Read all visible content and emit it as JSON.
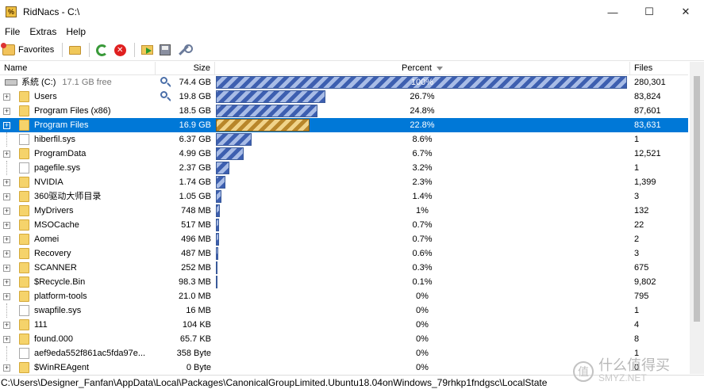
{
  "window": {
    "title": "RidNacs - C:\\",
    "icon_glyph": "%",
    "minimize_glyph": "—",
    "maximize_glyph": "☐",
    "close_glyph": "✕"
  },
  "menu": [
    {
      "label": "File"
    },
    {
      "label": "Extras"
    },
    {
      "label": "Help"
    }
  ],
  "toolbar": {
    "favorites_label": "Favorites",
    "icons": [
      "open-folder-icon",
      "refresh-icon",
      "stop-icon",
      "export-icon",
      "save-icon",
      "settings-wrench-icon"
    ]
  },
  "columns": {
    "name": "Name",
    "size": "Size",
    "percent": "Percent",
    "files": "Files"
  },
  "root": {
    "name": "系統 (C:)",
    "free": "17.1 GB free",
    "size": "74.4 GB",
    "percent": "100%",
    "fraction": 1.0,
    "files": "280,301"
  },
  "rows": [
    {
      "name": "Users",
      "type": "folder",
      "expandable": true,
      "size": "19.8 GB",
      "percent": "26.7%",
      "fraction": 0.267,
      "files": "83,824",
      "magnifier": true
    },
    {
      "name": "Program Files (x86)",
      "type": "folder",
      "expandable": true,
      "size": "18.5 GB",
      "percent": "24.8%",
      "fraction": 0.248,
      "files": "87,601"
    },
    {
      "name": "Program Files",
      "type": "folder",
      "expandable": true,
      "size": "16.9 GB",
      "percent": "22.8%",
      "fraction": 0.228,
      "files": "83,631",
      "selected": true
    },
    {
      "name": "hiberfil.sys",
      "type": "file",
      "expandable": false,
      "size": "6.37 GB",
      "percent": "8.6%",
      "fraction": 0.086,
      "files": "1"
    },
    {
      "name": "ProgramData",
      "type": "folder",
      "expandable": true,
      "size": "4.99 GB",
      "percent": "6.7%",
      "fraction": 0.067,
      "files": "12,521"
    },
    {
      "name": "pagefile.sys",
      "type": "file",
      "expandable": false,
      "size": "2.37 GB",
      "percent": "3.2%",
      "fraction": 0.032,
      "files": "1"
    },
    {
      "name": "NVIDIA",
      "type": "folder",
      "expandable": true,
      "size": "1.74 GB",
      "percent": "2.3%",
      "fraction": 0.023,
      "files": "1,399"
    },
    {
      "name": "360驱动大师目录",
      "type": "folder",
      "expandable": true,
      "size": "1.05 GB",
      "percent": "1.4%",
      "fraction": 0.014,
      "files": "3"
    },
    {
      "name": "MyDrivers",
      "type": "folder",
      "expandable": true,
      "size": "748 MB",
      "percent": "1%",
      "fraction": 0.01,
      "files": "132"
    },
    {
      "name": "MSOCache",
      "type": "folder",
      "expandable": true,
      "size": "517 MB",
      "percent": "0.7%",
      "fraction": 0.007,
      "files": "22"
    },
    {
      "name": "Aomei",
      "type": "folder",
      "expandable": true,
      "size": "496 MB",
      "percent": "0.7%",
      "fraction": 0.007,
      "files": "2"
    },
    {
      "name": "Recovery",
      "type": "folder",
      "expandable": true,
      "size": "487 MB",
      "percent": "0.6%",
      "fraction": 0.006,
      "files": "3"
    },
    {
      "name": "SCANNER",
      "type": "folder",
      "expandable": true,
      "size": "252 MB",
      "percent": "0.3%",
      "fraction": 0.003,
      "files": "675"
    },
    {
      "name": "$Recycle.Bin",
      "type": "folder",
      "expandable": true,
      "size": "98.3 MB",
      "percent": "0.1%",
      "fraction": 0.001,
      "files": "9,802"
    },
    {
      "name": "platform-tools",
      "type": "folder",
      "expandable": true,
      "size": "21.0 MB",
      "percent": "0%",
      "fraction": 0.0,
      "files": "795"
    },
    {
      "name": "swapfile.sys",
      "type": "file",
      "expandable": false,
      "size": "16 MB",
      "percent": "0%",
      "fraction": 0.0,
      "files": "1"
    },
    {
      "name": "111",
      "type": "folder",
      "expandable": true,
      "size": "104 KB",
      "percent": "0%",
      "fraction": 0.0,
      "files": "4"
    },
    {
      "name": "found.000",
      "type": "folder",
      "expandable": true,
      "size": "65.7 KB",
      "percent": "0%",
      "fraction": 0.0,
      "files": "8"
    },
    {
      "name": "aef9eda552f861ac5fda97e...",
      "type": "file",
      "expandable": false,
      "size": "358 Byte",
      "percent": "0%",
      "fraction": 0.0,
      "files": "1"
    },
    {
      "name": "$WinREAgent",
      "type": "folder",
      "expandable": true,
      "size": "0 Byte",
      "percent": "0%",
      "fraction": 0.0,
      "files": "0"
    }
  ],
  "status": {
    "path": "C:\\Users\\Designer_Fanfan\\AppData\\Local\\Packages\\CanonicalGroupLimited.Ubuntu18.04onWindows_79rhkp1fndgsc\\LocalState"
  },
  "watermark": {
    "glyph": "值",
    "line1": "什么值得买",
    "line2": "SMYZ.NET"
  }
}
